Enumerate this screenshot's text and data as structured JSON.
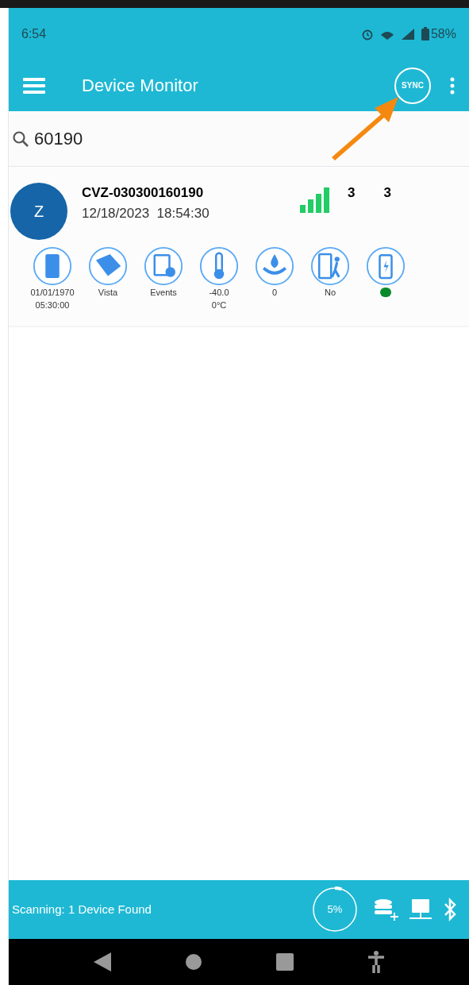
{
  "status_bar": {
    "time": "6:54",
    "battery": "58%"
  },
  "app_bar": {
    "title": "Device Monitor",
    "sync_label": "SYNC"
  },
  "search": {
    "value": "60190"
  },
  "devices": [
    {
      "avatar": "Z",
      "name": "CVZ-030300160190",
      "timestamp": "12/18/2023  18:54:30",
      "count_1": "3",
      "count_2": "3",
      "indicators": [
        {
          "kind": "clock",
          "lines": [
            "01/01/1970",
            "05:30:00"
          ]
        },
        {
          "kind": "tag",
          "lines": [
            "Vista"
          ]
        },
        {
          "kind": "events",
          "lines": [
            "Events"
          ]
        },
        {
          "kind": "temperature",
          "lines": [
            "-40.0",
            "0°C"
          ]
        },
        {
          "kind": "water",
          "lines": [
            "0"
          ]
        },
        {
          "kind": "door",
          "lines": [
            "No"
          ]
        },
        {
          "kind": "battery",
          "color": "#0a8a2a"
        }
      ]
    }
  ],
  "footer": {
    "status": "Scanning: 1 Device Found",
    "progress": {
      "label": "5%"
    }
  }
}
